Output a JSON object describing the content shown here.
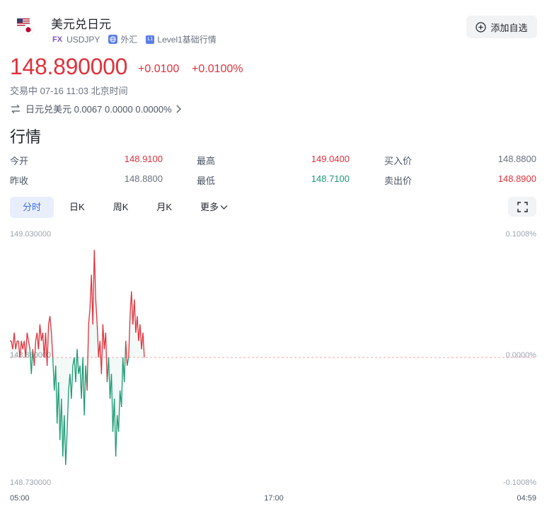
{
  "header": {
    "title": "美元兑日元",
    "fx_badge": "FX",
    "symbol": "USDJPY",
    "market": "外汇",
    "level": "Level1基础行情",
    "level_badge": "L1",
    "watch_label": "添加自选"
  },
  "quote": {
    "price": "148.890000",
    "change": "+0.0100",
    "change_pct": "+0.0100%",
    "status": "交易中 07-16 11:03 北京时间",
    "inverse": "日元兑美元 0.0067 0.0000 0.0000%"
  },
  "section_title": "行情",
  "stats": {
    "open_label": "今开",
    "open": "148.9100",
    "prev_close_label": "昨收",
    "prev_close": "148.8800",
    "high_label": "最高",
    "high": "149.0400",
    "low_label": "最低",
    "low": "148.7100",
    "bid_label": "买入价",
    "bid": "148.8800",
    "ask_label": "卖出价",
    "ask": "148.8900"
  },
  "tabs": [
    "分时",
    "日K",
    "周K",
    "月K",
    "更多"
  ],
  "colors": {
    "up": "#e0313b",
    "down": "#1a9a73",
    "accent": "#3a6fe0"
  },
  "chart_data": {
    "type": "line",
    "title": "",
    "y_left_ticks": [
      "149.030000",
      "148.880000",
      "148.730000"
    ],
    "y_right_ticks": [
      "0.1008%",
      "0.0000%",
      "-0.1008%"
    ],
    "x_ticks": [
      "05:00",
      "17:00",
      "04:59"
    ],
    "ylim": [
      148.73,
      149.03
    ],
    "baseline": 148.88,
    "series": [
      {
        "values": [
          148.9,
          148.9,
          148.89,
          148.91,
          148.89,
          148.9,
          148.9,
          148.88,
          148.9,
          148.89,
          148.9,
          148.88,
          148.91,
          148.9,
          148.89,
          148.86,
          148.89,
          148.87,
          148.9,
          148.91,
          148.89,
          148.92,
          148.9,
          148.91,
          148.88,
          148.91,
          148.87,
          148.92,
          148.93,
          148.91,
          148.88,
          148.84,
          148.87,
          148.8,
          148.85,
          148.78,
          148.83,
          148.76,
          148.81,
          148.75,
          148.79,
          148.84,
          148.86,
          148.83,
          148.87,
          148.88,
          148.85,
          148.89,
          148.86,
          148.87,
          148.83,
          148.88,
          148.81,
          148.87,
          148.84,
          148.92,
          148.94,
          148.98,
          148.92,
          149.01,
          148.95,
          148.92,
          148.88,
          148.9,
          148.86,
          148.92,
          148.89,
          148.91,
          148.85,
          148.88,
          148.83,
          148.86,
          148.79,
          148.83,
          148.76,
          148.81,
          148.79,
          148.84,
          148.82,
          148.88,
          148.85,
          148.9,
          148.87,
          148.88,
          148.93,
          148.96,
          148.92,
          148.95,
          148.91,
          148.93,
          148.9,
          148.92,
          148.89,
          148.91,
          148.88
        ]
      }
    ]
  }
}
